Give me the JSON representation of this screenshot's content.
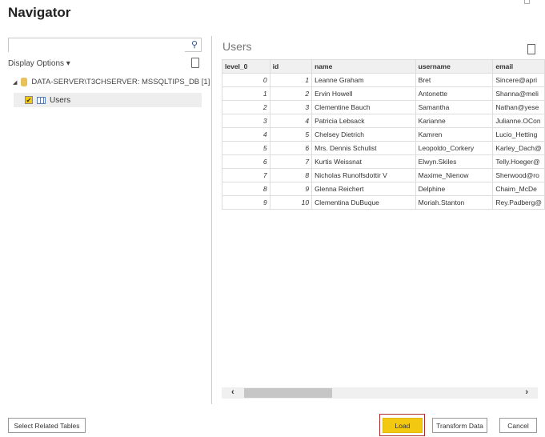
{
  "title": "Navigator",
  "search": {
    "placeholder": "",
    "icon": "search-icon"
  },
  "display_options": "Display Options ▾",
  "tree": {
    "server": "DATA-SERVER\\T3CHSERVER: MSSQLTIPS_DB [1]",
    "table": "Users",
    "table_checked": true
  },
  "preview": {
    "title": "Users",
    "columns": [
      "level_0",
      "id",
      "name",
      "username",
      "email"
    ],
    "rows": [
      [
        "0",
        "1",
        "Leanne Graham",
        "Bret",
        "Sincere@apri"
      ],
      [
        "1",
        "2",
        "Ervin Howell",
        "Antonette",
        "Shanna@meli"
      ],
      [
        "2",
        "3",
        "Clementine Bauch",
        "Samantha",
        "Nathan@yese"
      ],
      [
        "3",
        "4",
        "Patricia Lebsack",
        "Karianne",
        "Julianne.OCon"
      ],
      [
        "4",
        "5",
        "Chelsey Dietrich",
        "Kamren",
        "Lucio_Hetting"
      ],
      [
        "5",
        "6",
        "Mrs. Dennis Schulist",
        "Leopoldo_Corkery",
        "Karley_Dach@"
      ],
      [
        "6",
        "7",
        "Kurtis Weissnat",
        "Elwyn.Skiles",
        "Telly.Hoeger@"
      ],
      [
        "7",
        "8",
        "Nicholas Runolfsdottir V",
        "Maxime_Nienow",
        "Sherwood@ro"
      ],
      [
        "8",
        "9",
        "Glenna Reichert",
        "Delphine",
        "Chaim_McDe"
      ],
      [
        "9",
        "10",
        "Clementina DuBuque",
        "Moriah.Stanton",
        "Rey.Padberg@"
      ]
    ]
  },
  "scroll": {
    "left": "‹",
    "right": "›"
  },
  "buttons": {
    "select_related": "Select Related Tables",
    "load": "Load",
    "transform": "Transform Data",
    "cancel": "Cancel"
  },
  "colors": {
    "accent": "#f2c811",
    "highlight": "#b03030"
  }
}
